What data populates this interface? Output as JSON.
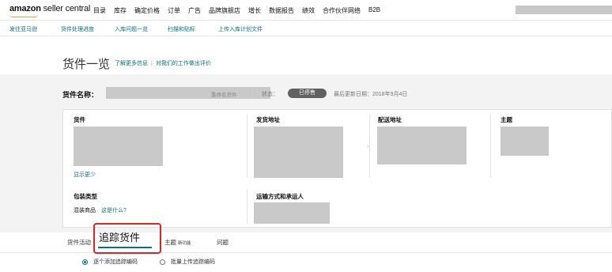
{
  "nav": {
    "logo_bold": "amazon",
    "logo_rest": " seller central",
    "menu": [
      "目录",
      "库存",
      "确定价格",
      "订单",
      "广告",
      "品牌旗舰店",
      "增长",
      "数据报告",
      "绩效",
      "合作伙伴网络",
      "B2B"
    ]
  },
  "subnav": [
    "发往亚马逊",
    "货件处理进度",
    "入库问题一览",
    "扫描和贴标",
    "上传入库计划文件"
  ],
  "page": {
    "title": "货件一览",
    "learn_more": "了解更多信息",
    "separator": "|",
    "rate": "对我们的工作做出评价"
  },
  "shipment": {
    "name_label": "货件名称：",
    "rename": "重命名货件",
    "status_label": "状态：",
    "status": "已停售",
    "updated": "最后更新日期：2018年9月4日"
  },
  "card": {
    "col1": "货件",
    "col2": "发货地址",
    "col3": "配送地址",
    "col4": "主题",
    "show_less": "显示更少",
    "packaging_head": "包装类型",
    "packaging_value": "混装商品",
    "packaging_help": "这是什么?",
    "shipping_head": "运输方式和承运人"
  },
  "tabs": {
    "activity": "货件活动",
    "tracking": "追踪货件",
    "theme": "主题",
    "theme_badge": "新功能",
    "issues": "问题"
  },
  "radios": {
    "one_by_one": "逐个添加追踪编码",
    "bulk": "批量上传追踪编码"
  },
  "colors": {
    "accent": "#0b6f7c",
    "badge": "#616161",
    "highlight": "#d9262a"
  }
}
